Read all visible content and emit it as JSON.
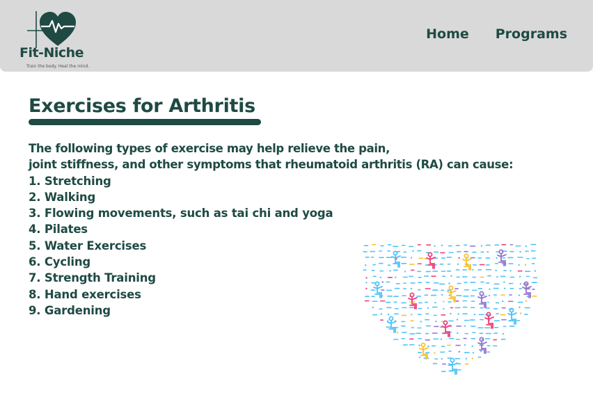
{
  "header": {
    "brand_name": "Fit-Niche",
    "tagline": "Train the body. Heal the mind.",
    "logo_icon": "heart-pulse-icon",
    "nav": [
      {
        "label": "Home"
      },
      {
        "label": "Programs"
      }
    ],
    "background": "#d9d9d9",
    "accent": "#1f4a44"
  },
  "main": {
    "title": "Exercises for Arthritis",
    "intro_line1": "The following types of exercise may help relieve the pain,",
    "intro_line2": "joint stiffness, and other symptoms that rheumatoid arthritis (RA) can cause:",
    "exercises": [
      "1. Stretching",
      "2. Walking",
      "3. Flowing movements, such as tai chi and yoga",
      "4. Pilates",
      "5. Water Exercises",
      "6. Cycling",
      "7. Strength Training",
      "8. Hand exercises",
      "9. Gardening"
    ],
    "illustration": {
      "icon": "heart-of-exercise-figures-icon",
      "colors": [
        "#4fc3f7",
        "#ec407a",
        "#fbc02d",
        "#9575cd"
      ]
    }
  }
}
